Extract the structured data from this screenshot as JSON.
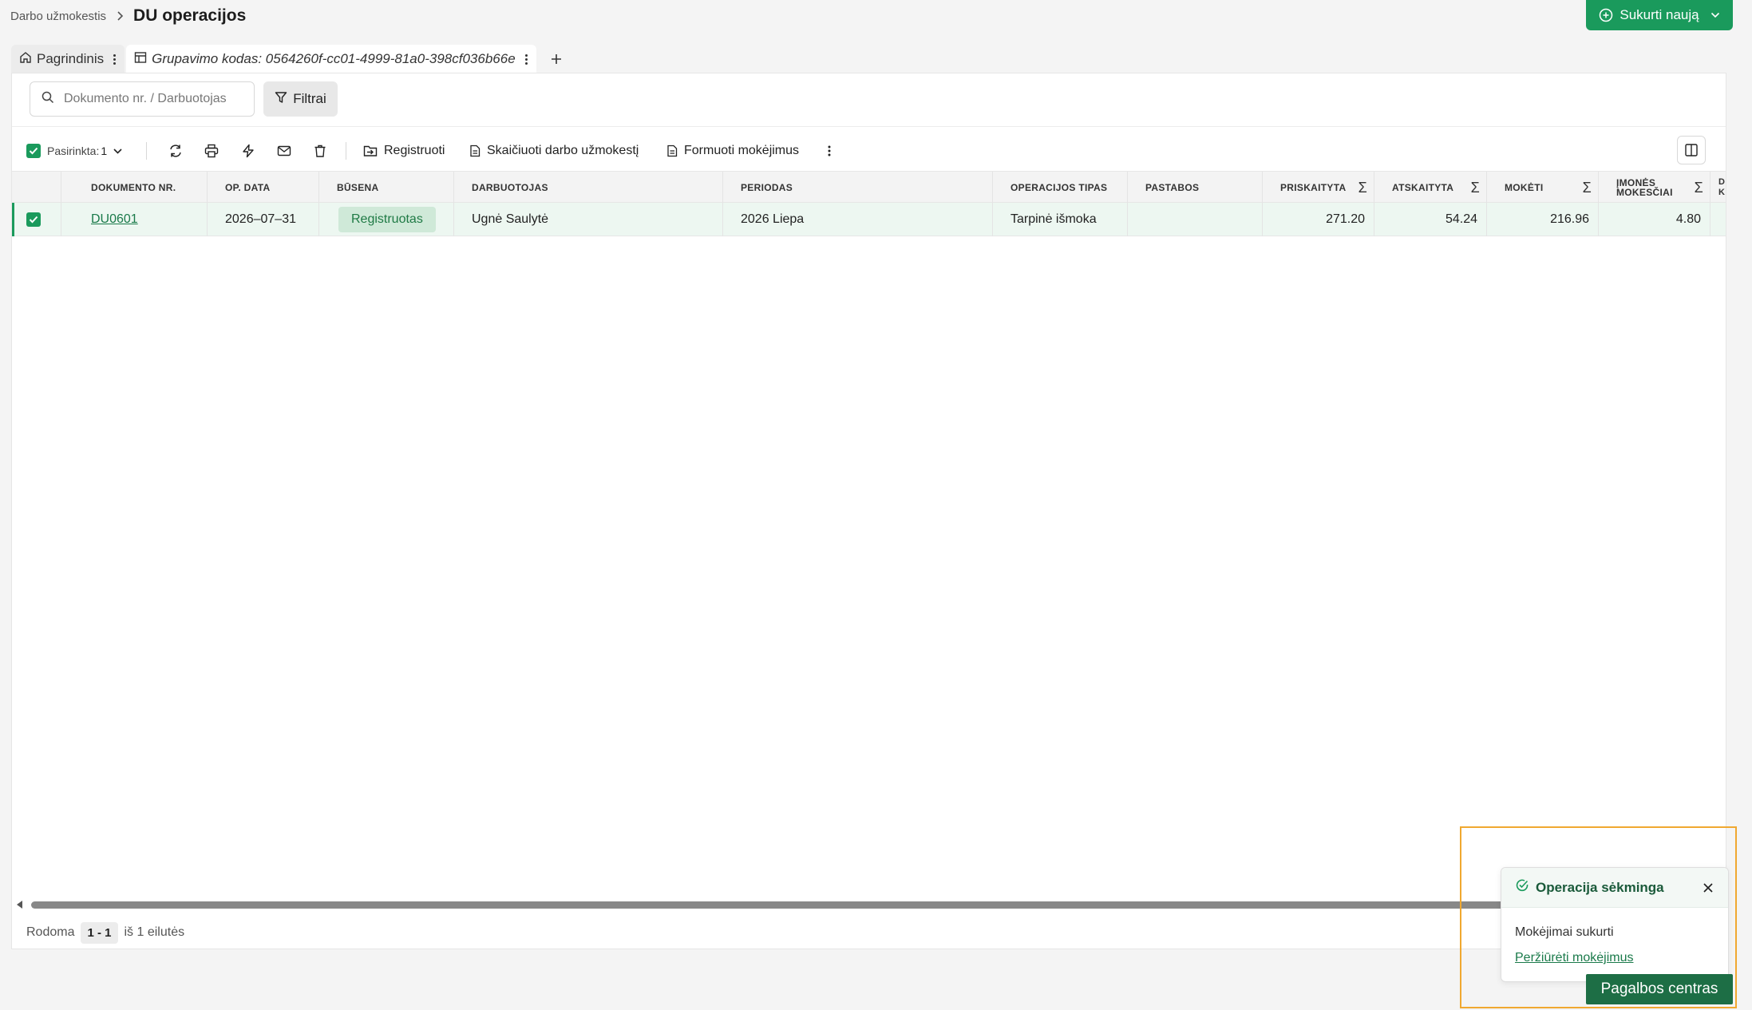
{
  "breadcrumb": {
    "parent": "Darbo užmokestis",
    "current": "DU operacijos"
  },
  "header": {
    "create_button": "Sukurti naują"
  },
  "tabs": [
    {
      "label": "Pagrindinis",
      "icon": "home-icon"
    },
    {
      "label": "Grupavimo kodas: 0564260f-cc01-4999-81a0-398cf036b66e",
      "icon": "table-icon"
    }
  ],
  "search": {
    "placeholder": "Dokumento nr. / Darbuotojas"
  },
  "filter": {
    "label": "Filtrai"
  },
  "toolbar": {
    "selected_label": "Pasirinkta:",
    "selected_count": "1",
    "register": "Registruoti",
    "calculate": "Skaičiuoti darbo užmokestį",
    "payments": "Formuoti mokėjimus"
  },
  "table": {
    "columns": [
      "DOKUMENTO NR.",
      "OP. DATA",
      "BŪSENA",
      "DARBUOTOJAS",
      "PERIODAS",
      "OPERACIJOS TIPAS",
      "PASTABOS",
      "PRISKAITYTA",
      "ATSKAITYTA",
      "MOKĖTI",
      "ĮMONĖS MOKESČIAI",
      "D K"
    ],
    "rows": [
      {
        "doc": "DU0601",
        "date": "2026–07–31",
        "status": "Registruotas",
        "employee": "Ugnė Saulytė",
        "period": "2026 Liepa",
        "type": "Tarpinė išmoka",
        "notes": "",
        "accrued": "271.20",
        "deducted": "54.24",
        "pay": "216.96",
        "company_tax": "4.80"
      }
    ]
  },
  "footer": {
    "showing": "Rodoma",
    "range": "1 - 1",
    "of": "iš 1 eilutės"
  },
  "toast": {
    "title": "Operacija sėkminga",
    "message": "Mokėjimai sukurti",
    "link": "Peržiūrėti mokėjimus"
  },
  "help": {
    "label": "Pagalbos centras"
  },
  "colors": {
    "accent": "#1a9a5c",
    "highlight": "#f0a830"
  }
}
